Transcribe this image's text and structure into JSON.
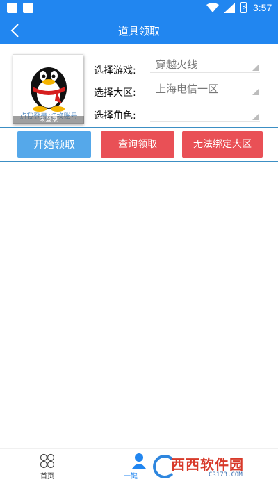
{
  "status_bar": {
    "time": "3:57"
  },
  "title_bar": {
    "title": "道具领取"
  },
  "avatar": {
    "login_prompt": "点我登录/切换账号",
    "status": "未登录"
  },
  "form": {
    "game_label": "选择游戏:",
    "game_value": "穿越火线",
    "region_label": "选择大区:",
    "region_value": "上海电信一区",
    "role_label": "选择角色:",
    "role_value": ""
  },
  "buttons": {
    "start": "开始领取",
    "query": "查询领取",
    "bind": "无法绑定大区"
  },
  "colors": {
    "primary": "#2186f0",
    "start_button": "#55a8ea",
    "danger_button": "#e95056"
  },
  "bottom_nav": {
    "home": "首页",
    "one_key": "一键"
  },
  "watermark": {
    "brand": "西西软件园",
    "site": "CR173.COM"
  }
}
